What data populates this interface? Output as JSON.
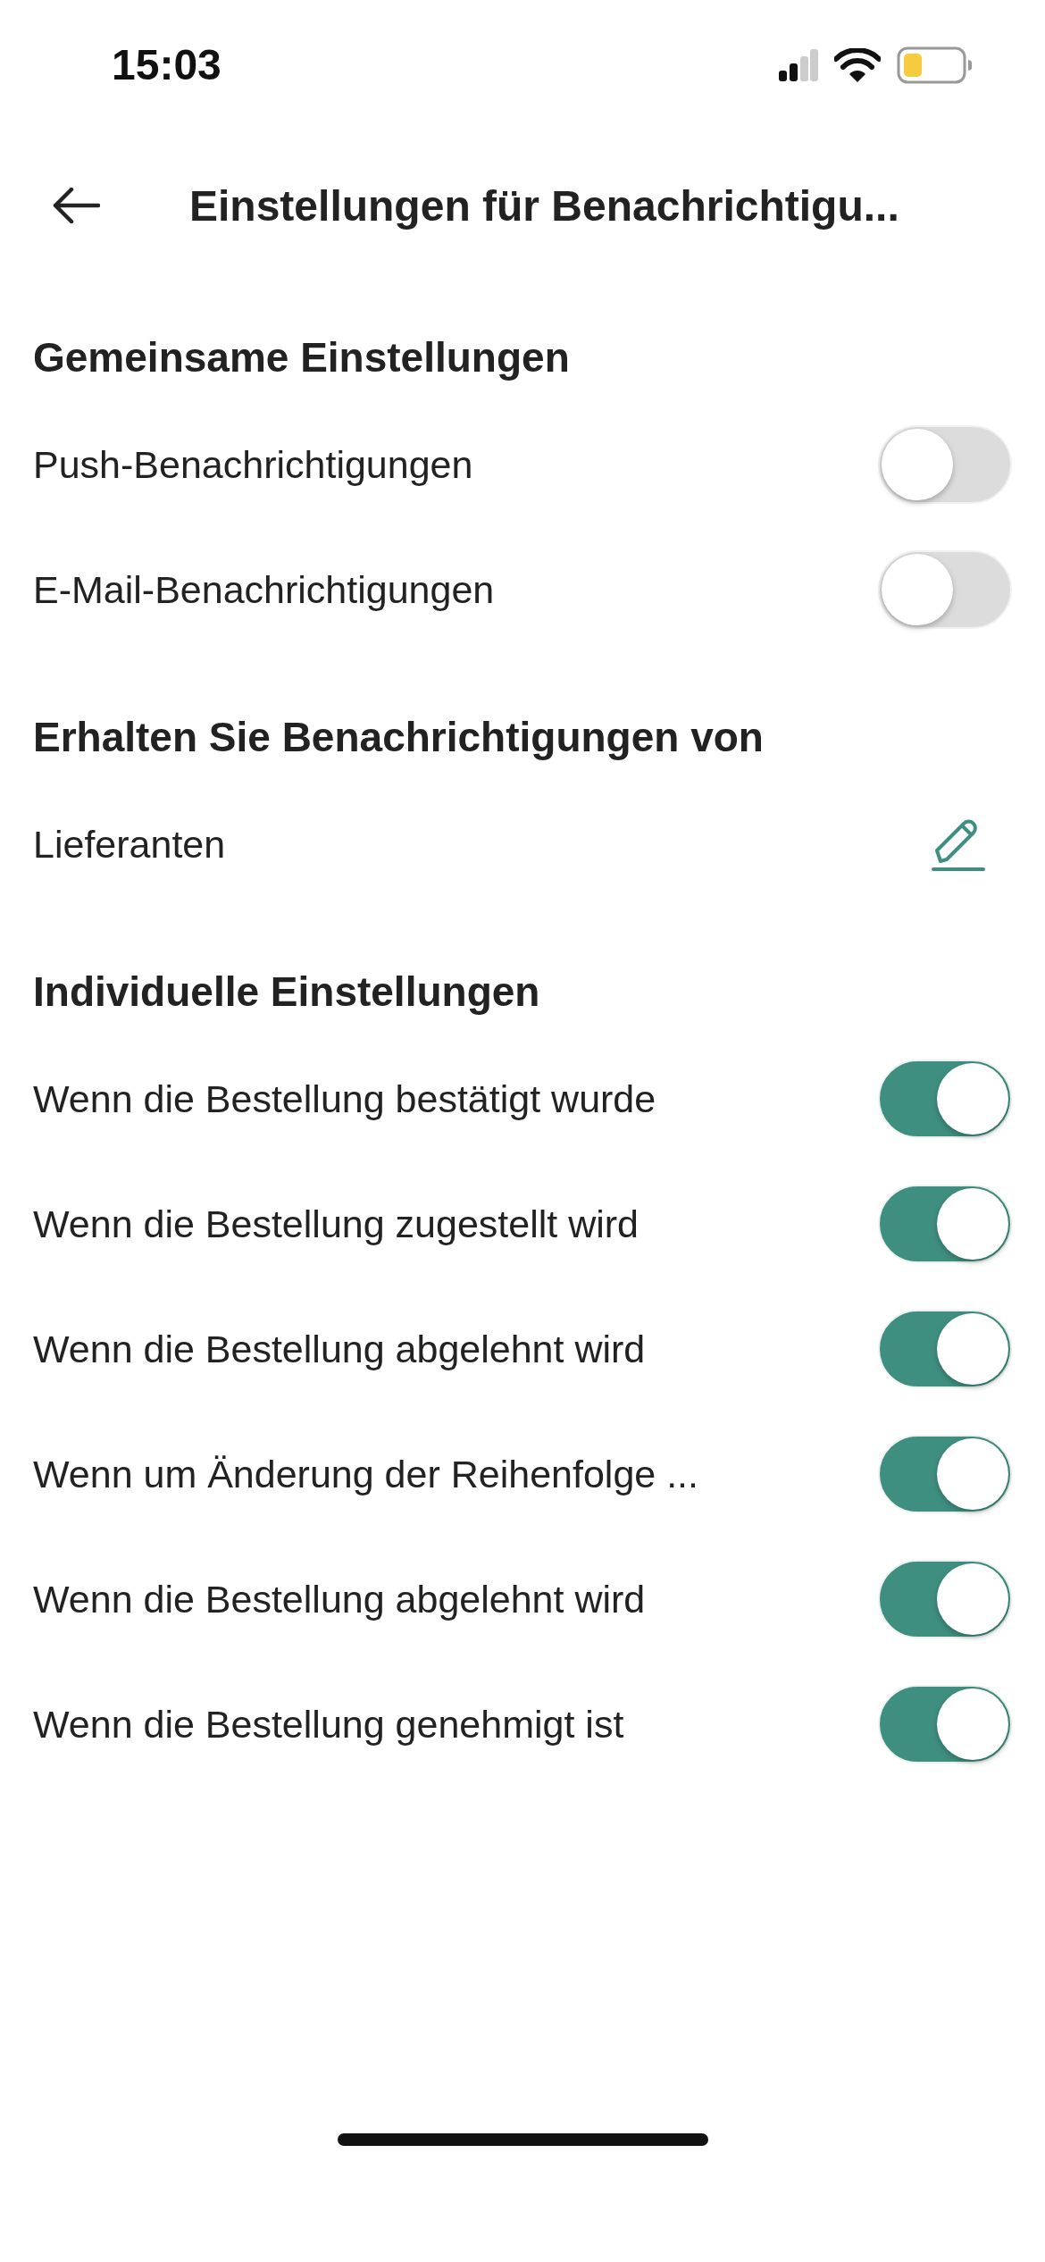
{
  "status_bar": {
    "time": "15:03"
  },
  "header": {
    "title": "Einstellungen für Benachrichtigu..."
  },
  "sections": [
    {
      "title": "Gemeinsame Einstellungen",
      "items": [
        {
          "kind": "toggle",
          "label": "Push-Benachrichtigungen",
          "on": false
        },
        {
          "kind": "toggle",
          "label": "E-Mail-Benachrichtigungen",
          "on": false
        }
      ]
    },
    {
      "title": "Erhalten Sie Benachrichtigungen von",
      "items": [
        {
          "kind": "edit",
          "label": "Lieferanten"
        }
      ]
    },
    {
      "title": "Individuelle Einstellungen",
      "items": [
        {
          "kind": "toggle",
          "label": "Wenn die Bestellung bestätigt wurde",
          "on": true
        },
        {
          "kind": "toggle",
          "label": "Wenn die Bestellung zugestellt wird",
          "on": true
        },
        {
          "kind": "toggle",
          "label": "Wenn die Bestellung abgelehnt wird",
          "on": true
        },
        {
          "kind": "toggle",
          "label": "Wenn um Änderung der Reihenfolge ...",
          "on": true
        },
        {
          "kind": "toggle",
          "label": "Wenn die Bestellung abgelehnt wird",
          "on": true
        },
        {
          "kind": "toggle",
          "label": "Wenn die Bestellung genehmigt ist",
          "on": true
        }
      ]
    }
  ]
}
